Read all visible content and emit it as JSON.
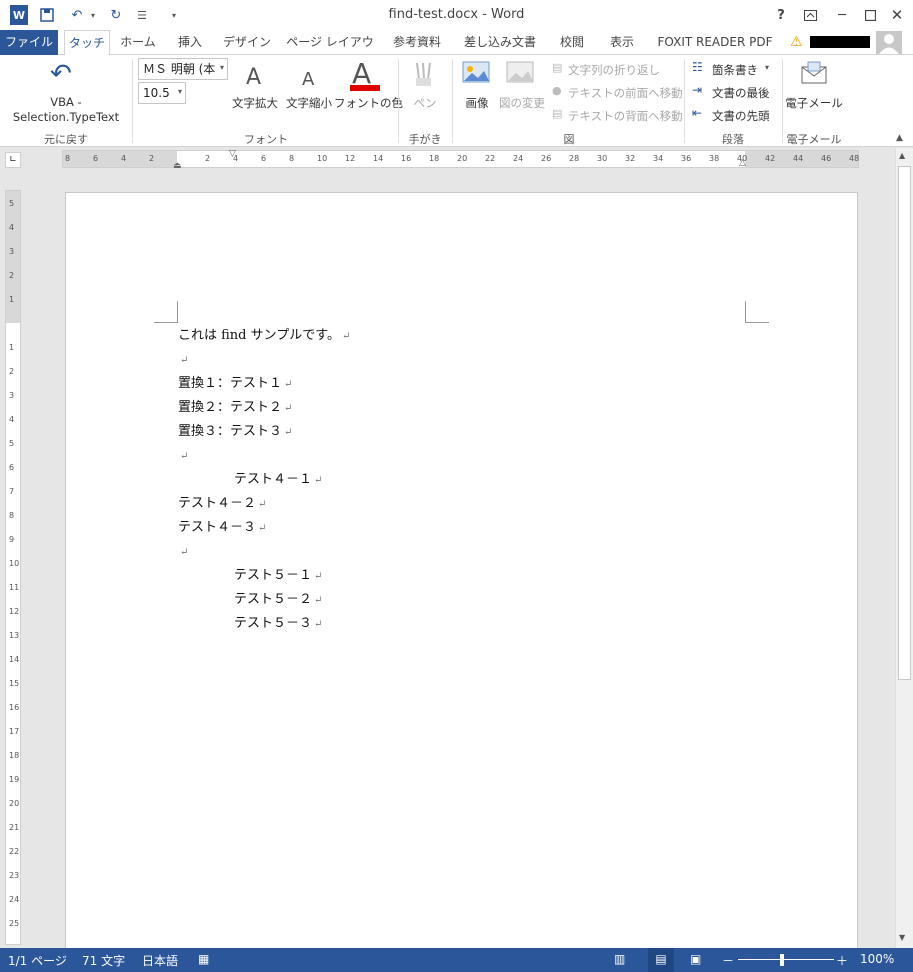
{
  "window": {
    "title": "find-test.docx - Word",
    "help": "?",
    "user_name_redacted": ""
  },
  "tabs": [
    "ファイル",
    "タッチ",
    "ホーム",
    "挿入",
    "デザイン",
    "ページ レイアウト",
    "参考資料",
    "差し込み文書",
    "校閲",
    "表示",
    "FOXIT READER PDF"
  ],
  "ribbon": {
    "undo": {
      "label_line1": "VBA -",
      "label_line2": "Selection.TypeText",
      "group": "元に戻す"
    },
    "font": {
      "name": "ＭＳ 明朝 (本",
      "size": "10.5",
      "grow": "文字拡大",
      "shrink": "文字縮小",
      "color": "フォントの色",
      "group": "フォント"
    },
    "ink": {
      "pen": "ペン",
      "group": "手がき"
    },
    "picture": {
      "image": "画像",
      "change": "図の変更",
      "wrap": "文字列の折り返し",
      "front": "テキストの前面へ移動",
      "back": "テキストの背面へ移動",
      "group": "図"
    },
    "paragraph": {
      "bullets": "箇条書き",
      "end": "文書の最後",
      "start": "文書の先頭",
      "group": "段落"
    },
    "email": {
      "mail": "電子メール",
      "group": "電子メール"
    }
  },
  "document": {
    "lines": [
      {
        "text": "これは find サンプルです。",
        "indent": false
      },
      {
        "text": "",
        "indent": false
      },
      {
        "text": "置換１：テスト１",
        "indent": false
      },
      {
        "text": "置換２：テスト２",
        "indent": false
      },
      {
        "text": "置換３：テスト３",
        "indent": false
      },
      {
        "text": "",
        "indent": false
      },
      {
        "text": "テスト４－１",
        "indent": true
      },
      {
        "text": "テスト４－２",
        "indent": false
      },
      {
        "text": "テスト４－３",
        "indent": false
      },
      {
        "text": "",
        "indent": false
      },
      {
        "text": "テスト５－１",
        "indent": true
      },
      {
        "text": "テスト５－２",
        "indent": true
      },
      {
        "text": "テスト５－３",
        "indent": true
      }
    ],
    "para_mark": "↵"
  },
  "status": {
    "page": "1/1 ページ",
    "words": "71 文字",
    "lang": "日本語",
    "zoom": "100%"
  },
  "colors": {
    "accent": "#2b579a",
    "font_color_bar": "#e00000"
  }
}
